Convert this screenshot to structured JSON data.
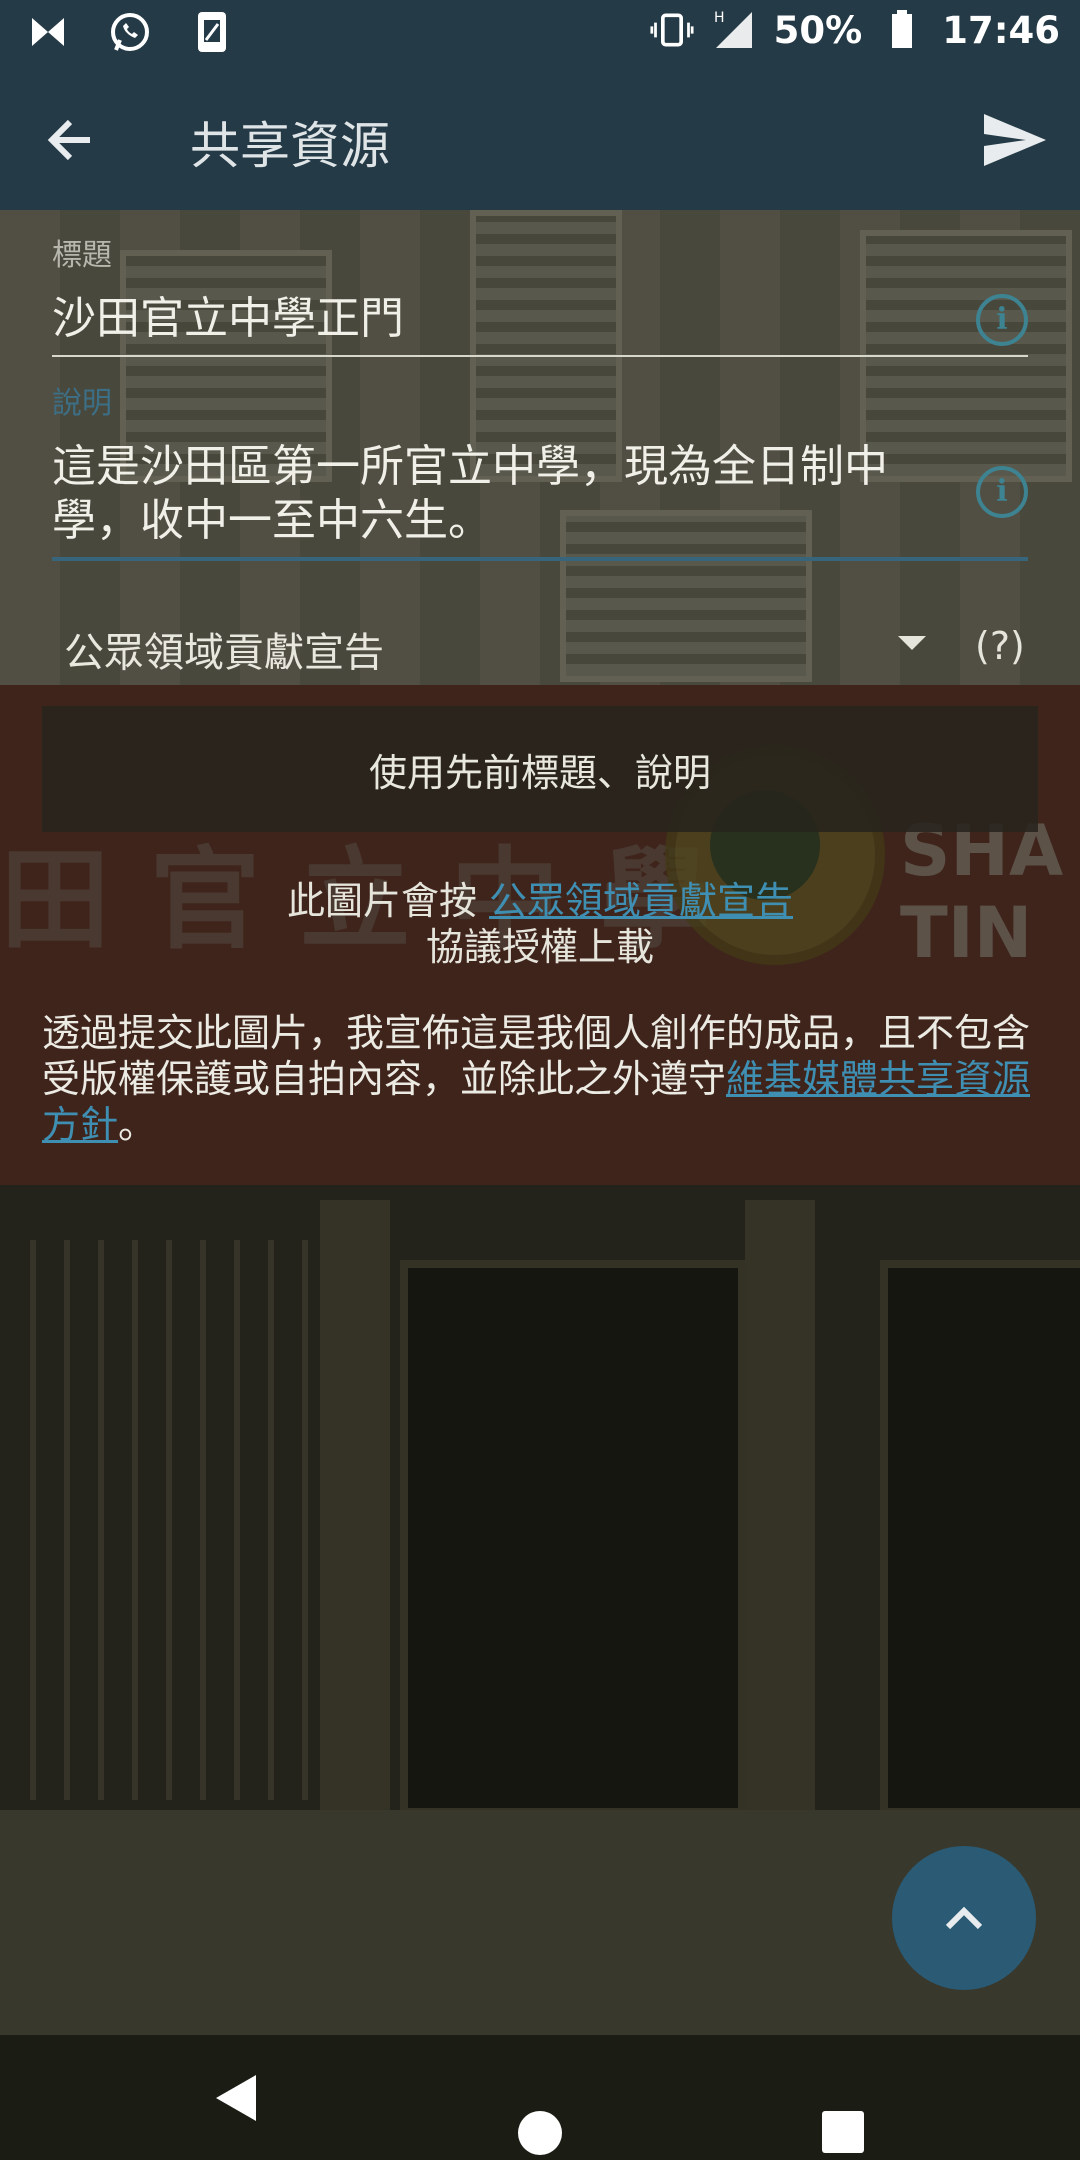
{
  "status_bar": {
    "battery": "50%",
    "time": "17:46",
    "network_type": "H",
    "icons": [
      "cross-app-icon",
      "whatsapp-icon",
      "sim-icon",
      "vibrate-icon",
      "signal-icon",
      "battery-icon"
    ]
  },
  "app_bar": {
    "title": "共享資源"
  },
  "form": {
    "title_label": "標題",
    "title_value": "沙田官立中學正門",
    "description_label": "說明",
    "description_value": "這是沙田區第一所官立中學，現為全日制中學，收中一至中六生。",
    "license_selected": "公眾領域貢獻宣告",
    "help_text": "(?)",
    "use_previous_button": "使用先前標題、說明",
    "license_note_prefix": "此圖片會按 ",
    "license_note_link": "公眾領域貢獻宣告",
    "license_note_suffix": "協議授權上載",
    "declaration_text": "透過提交此圖片，我宣佈這是我個人創作的成品，且不包含受版權保護或自拍內容，並除此之外遵守",
    "declaration_link": "維基媒體共享資源方針",
    "declaration_end": "。"
  },
  "photo_sign": {
    "chinese": "田官立中學",
    "english": "SHA TIN"
  },
  "colors": {
    "app_bar": "#253a47",
    "accent": "#3e8391",
    "link": "#3f8fb3",
    "fab": "#2a5a74"
  }
}
